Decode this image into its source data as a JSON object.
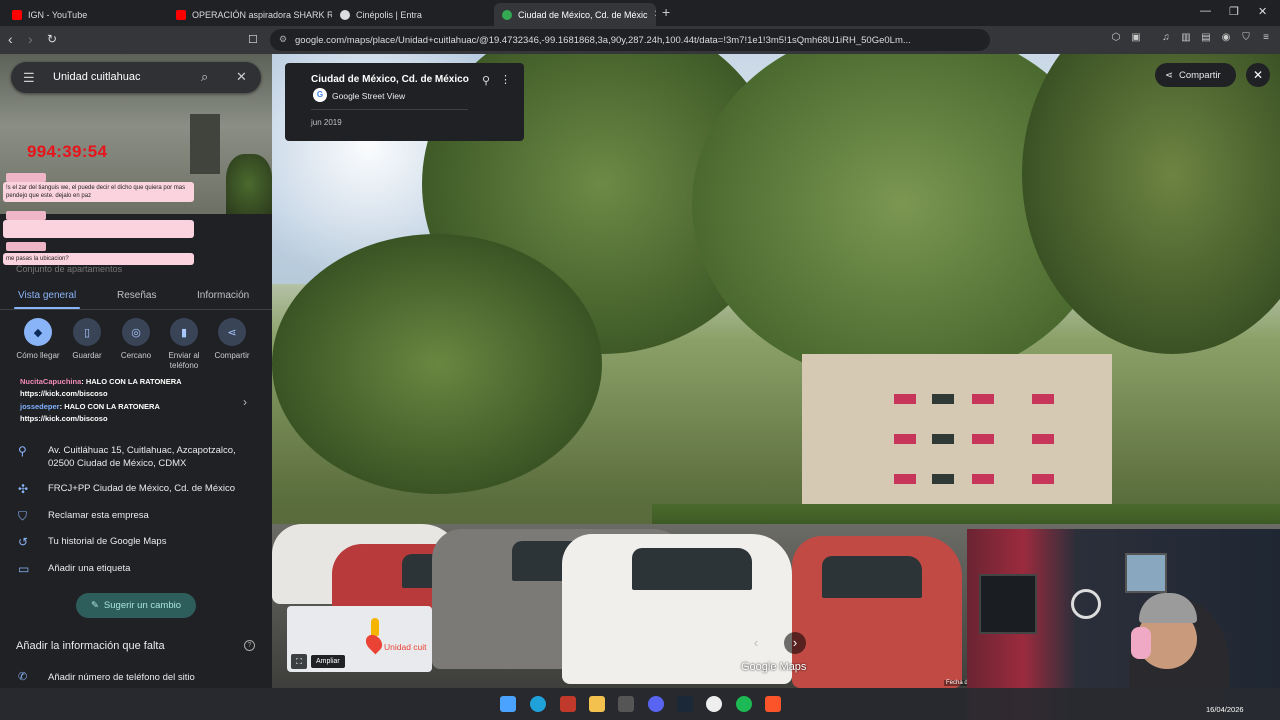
{
  "browser": {
    "tabs": [
      {
        "title": "IGN - YouTube",
        "color": "#ff0000"
      },
      {
        "title": "OPERACIÓN aspiradora SHARK Resc",
        "color": "#ff0000"
      },
      {
        "title": "Cinépolis | Entra",
        "color": "#dadce0"
      },
      {
        "title": "Ciudad de México, Cd. de Méxic",
        "color": "#34a853",
        "active": true
      }
    ],
    "new_tab_icon": "plus-icon",
    "url": "google.com/maps/place/Unidad+cuitlahuac/@19.4732346,-99.1681868,3a,90y,287.24h,100.44t/data=!3m7!1e1!3m5!1sQmh68U1iRH_50Ge0Lm..."
  },
  "sidebar": {
    "search_query": "Unidad cuitlahuac",
    "stream_timer": "994:39:54",
    "chat_overlay": [
      "!s el zar del tianguis we, el puede decir el dicho que quiera por mas pendejo que este. dejalo en paz",
      "me pasas la ubicacion?"
    ],
    "partial_text": "Conjunto de apartamentos",
    "tabs": [
      "Vista general",
      "Reseñas",
      "Información"
    ],
    "actions": [
      {
        "label": "Cómo llegar",
        "icon": "directions-icon"
      },
      {
        "label": "Guardar",
        "icon": "bookmark-icon"
      },
      {
        "label": "Cercano",
        "icon": "nearby-icon"
      },
      {
        "label": "Enviar al teléfono",
        "icon": "phone-send-icon"
      },
      {
        "label": "Compartir",
        "icon": "share-icon"
      }
    ],
    "chat_lines": [
      {
        "nick": "NucitaCapuchina",
        "text": ": HALO CON LA RATONERA https://kick.com/biscoso"
      },
      {
        "nick": "jossedeper",
        "text": ": HALO CON LA RATONERA https://kick.com/biscoso"
      }
    ],
    "info": [
      {
        "icon": "location-pin-icon",
        "text": "Av. Cuitláhuac 15, Cuitlahuac, Azcapotzalco, 02500 Ciudad de México, CDMX"
      },
      {
        "icon": "plus-code-icon",
        "text": "FRCJ+PP Ciudad de México, Cd. de México"
      },
      {
        "icon": "verified-shield-icon",
        "text": "Reclamar esta empresa"
      },
      {
        "icon": "history-icon",
        "text": "Tu historial de Google Maps"
      },
      {
        "icon": "label-icon",
        "text": "Añadir una etiqueta"
      }
    ],
    "suggest_button": "Sugerir un cambio",
    "missing_heading": "Añadir la información que falta",
    "add_phone": "Añadir número de teléfono del sitio"
  },
  "streetview": {
    "place_title": "Ciudad de México, Cd. de México",
    "provider": "Google Street View",
    "capture_date": "jun 2019",
    "share_label": "Compartir",
    "minimap_label": "Unidad cuit",
    "expand_label": "Ampliar",
    "watermark": "Google Maps",
    "date_hint": "Fecha d"
  },
  "taskbar": {
    "date": "16/04/2026"
  }
}
